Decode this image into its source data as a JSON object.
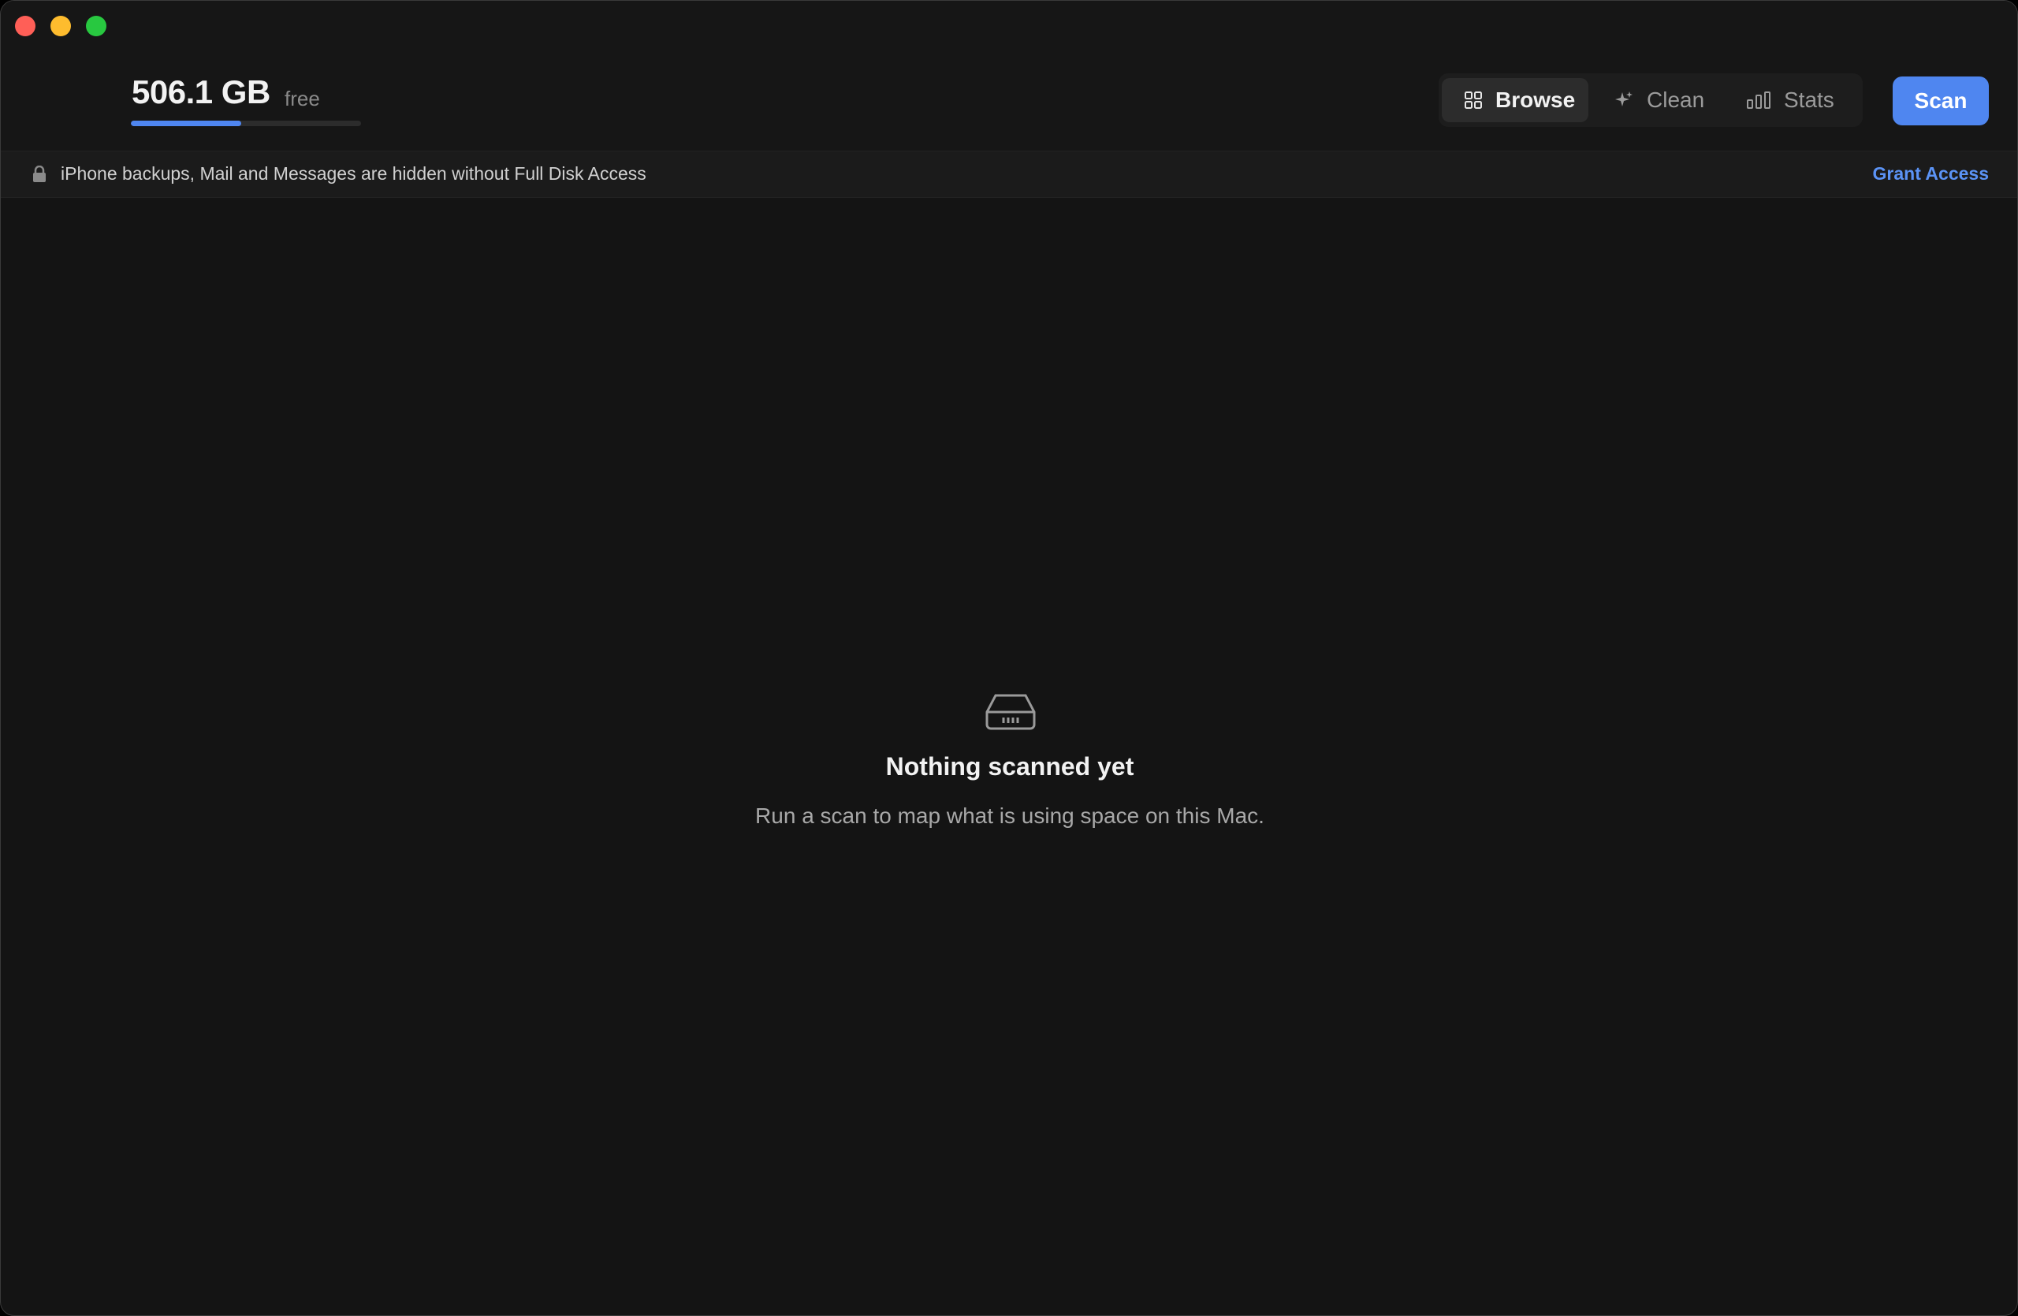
{
  "window": {
    "traffic_lights": [
      "close",
      "minimize",
      "zoom"
    ]
  },
  "disk": {
    "size": "506.1 GB",
    "free_label": "free",
    "usage_fraction": 0.48,
    "accent_color": "#4f86f0"
  },
  "tabs": [
    {
      "label": "Browse",
      "icon": "grid-icon",
      "active": true
    },
    {
      "label": "Clean",
      "icon": "sparkle-icon",
      "active": false
    },
    {
      "label": "Stats",
      "icon": "bar-chart-icon",
      "active": false
    }
  ],
  "scan_button": {
    "label": "Scan"
  },
  "banner": {
    "icon": "lock-icon",
    "text": "iPhone backups, Mail and Messages are hidden without Full Disk Access",
    "action": "Grant Access"
  },
  "empty_state": {
    "icon": "drive-icon",
    "title": "Nothing scanned yet",
    "subtitle": "Run a scan to map what is using space on this Mac."
  }
}
